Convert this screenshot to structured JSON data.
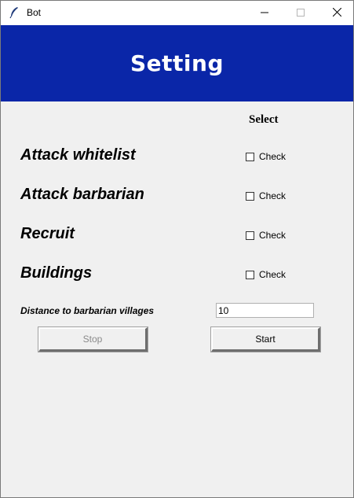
{
  "window": {
    "title": "Bot",
    "app_icon": "feather-icon",
    "controls": [
      "minimize-icon",
      "maximize-icon",
      "close-icon"
    ]
  },
  "header": {
    "title": "Setting",
    "background": "#0a26a8"
  },
  "options": {
    "column_header": "Select",
    "rows": [
      {
        "label": "Attack whitelist",
        "check_label": "Check",
        "checked": false
      },
      {
        "label": "Attack barbarian",
        "check_label": "Check",
        "checked": false
      },
      {
        "label": "Recruit",
        "check_label": "Check",
        "checked": false
      },
      {
        "label": "Buildings",
        "check_label": "Check",
        "checked": false
      }
    ]
  },
  "distance": {
    "label": "Distance to barbarian villages",
    "value": "10"
  },
  "buttons": {
    "stop_label": "Stop",
    "start_label": "Start"
  }
}
